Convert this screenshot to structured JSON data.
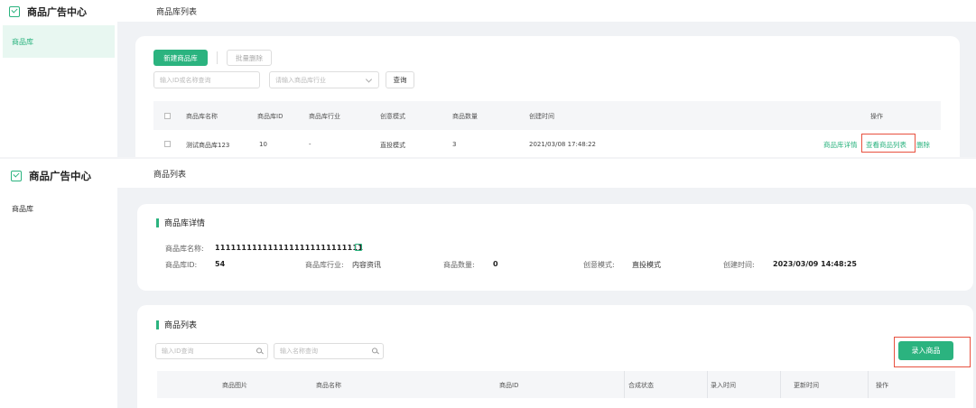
{
  "brand": {
    "color": "#2bb37f",
    "alert": "#e8513f"
  },
  "screen_a": {
    "app_title": "商品广告中心",
    "sidebar": {
      "item": "商品库"
    },
    "header_title": "商品库列表",
    "toolbar": {
      "new_label": "新建商品库",
      "batch_delete_label": "批量删除"
    },
    "filters": {
      "id_name_placeholder": "输入ID或名称查询",
      "industry_placeholder": "请输入商品库行业",
      "query_label": "查询"
    },
    "table": {
      "headers": [
        "商品库名称",
        "商品库ID",
        "商品库行业",
        "创意模式",
        "商品数量",
        "创建时间",
        "操作"
      ],
      "row": {
        "name": "测试商品库123",
        "id": "10",
        "industry": "-",
        "mode": "直投模式",
        "count": "3",
        "created": "2021/03/08 17:48:22"
      },
      "actions": {
        "detail": "商品库详情",
        "view_list": "查看商品列表",
        "delete": "删除"
      }
    }
  },
  "screen_b": {
    "app_title": "商品广告中心",
    "sidebar": {
      "item": "商品库"
    },
    "header_title": "商品列表",
    "detail": {
      "title": "商品库详情",
      "name_label": "商品库名称:",
      "name_value": "1111111111111111111111111111",
      "id_label": "商品库ID:",
      "id_value": "54",
      "industry_label": "商品库行业:",
      "industry_value": "内容资讯",
      "count_label": "商品数量:",
      "count_value": "0",
      "mode_label": "创意模式:",
      "mode_value": "直投模式",
      "created_label": "创建时间:",
      "created_value": "2023/03/09 14:48:25"
    },
    "list": {
      "title": "商品列表",
      "id_placeholder": "输入ID查询",
      "name_placeholder": "输入名称查询",
      "import_label": "录入商品",
      "headers": [
        "商品图片",
        "商品名称",
        "商品ID",
        "合成状态",
        "录入时间",
        "更新时间",
        "操作"
      ]
    }
  }
}
